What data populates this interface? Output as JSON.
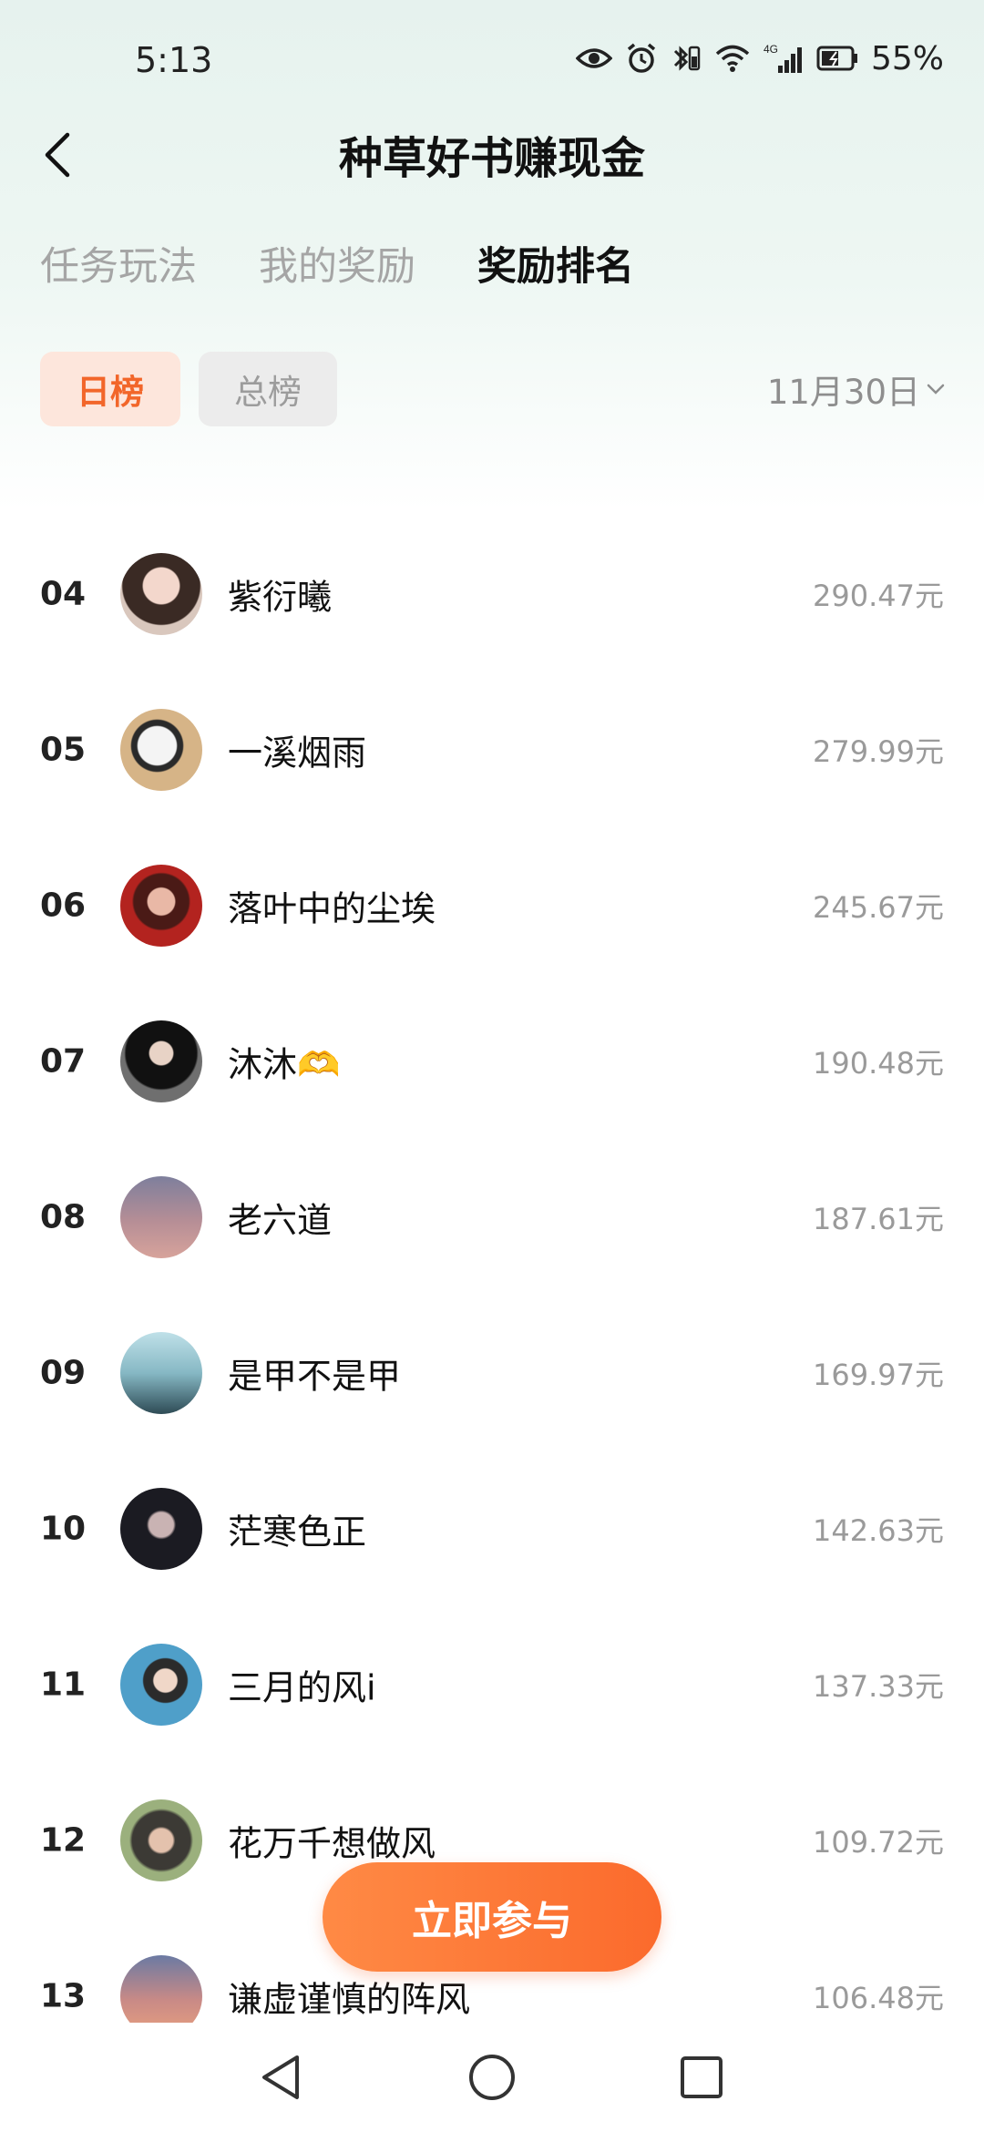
{
  "status_bar": {
    "time": "5:13",
    "network": "4G",
    "battery": "55%"
  },
  "header": {
    "title": "种草好书赚现金"
  },
  "tabs": [
    {
      "label": "任务玩法",
      "active": false
    },
    {
      "label": "我的奖励",
      "active": false
    },
    {
      "label": "奖励排名",
      "active": true
    }
  ],
  "filters": {
    "day_label": "日榜",
    "total_label": "总榜",
    "selected": "日榜",
    "date": "11月30日"
  },
  "ranking": [
    {
      "rank": "04",
      "name": "紫衍曦",
      "amount": "290.47元",
      "avatar": "avatar-portrait-icon"
    },
    {
      "rank": "05",
      "name": "一溪烟雨",
      "amount": "279.99元",
      "avatar": "avatar-portrait-icon"
    },
    {
      "rank": "06",
      "name": "落叶中的尘埃",
      "amount": "245.67元",
      "avatar": "avatar-portrait-icon"
    },
    {
      "rank": "07",
      "name": "沐沐🫶",
      "amount": "190.48元",
      "avatar": "avatar-portrait-icon"
    },
    {
      "rank": "08",
      "name": "老六道",
      "amount": "187.61元",
      "avatar": "avatar-calligraphy-icon"
    },
    {
      "rank": "09",
      "name": "是甲不是甲",
      "amount": "169.97元",
      "avatar": "avatar-portrait-icon"
    },
    {
      "rank": "10",
      "name": "茫寒色正",
      "amount": "142.63元",
      "avatar": "avatar-portrait-icon"
    },
    {
      "rank": "11",
      "name": "三月的风i",
      "amount": "137.33元",
      "avatar": "avatar-portrait-icon"
    },
    {
      "rank": "12",
      "name": "花万千想做风",
      "amount": "109.72元",
      "avatar": "avatar-portrait-icon"
    },
    {
      "rank": "13",
      "name": "谦虚谨慎的阵风",
      "amount": "106.48元",
      "avatar": "avatar-sky-icon"
    }
  ],
  "action": {
    "join_label": "立即参与"
  },
  "colors": {
    "accent": "#f2662a",
    "top_gradient": "#e6f2ee"
  }
}
